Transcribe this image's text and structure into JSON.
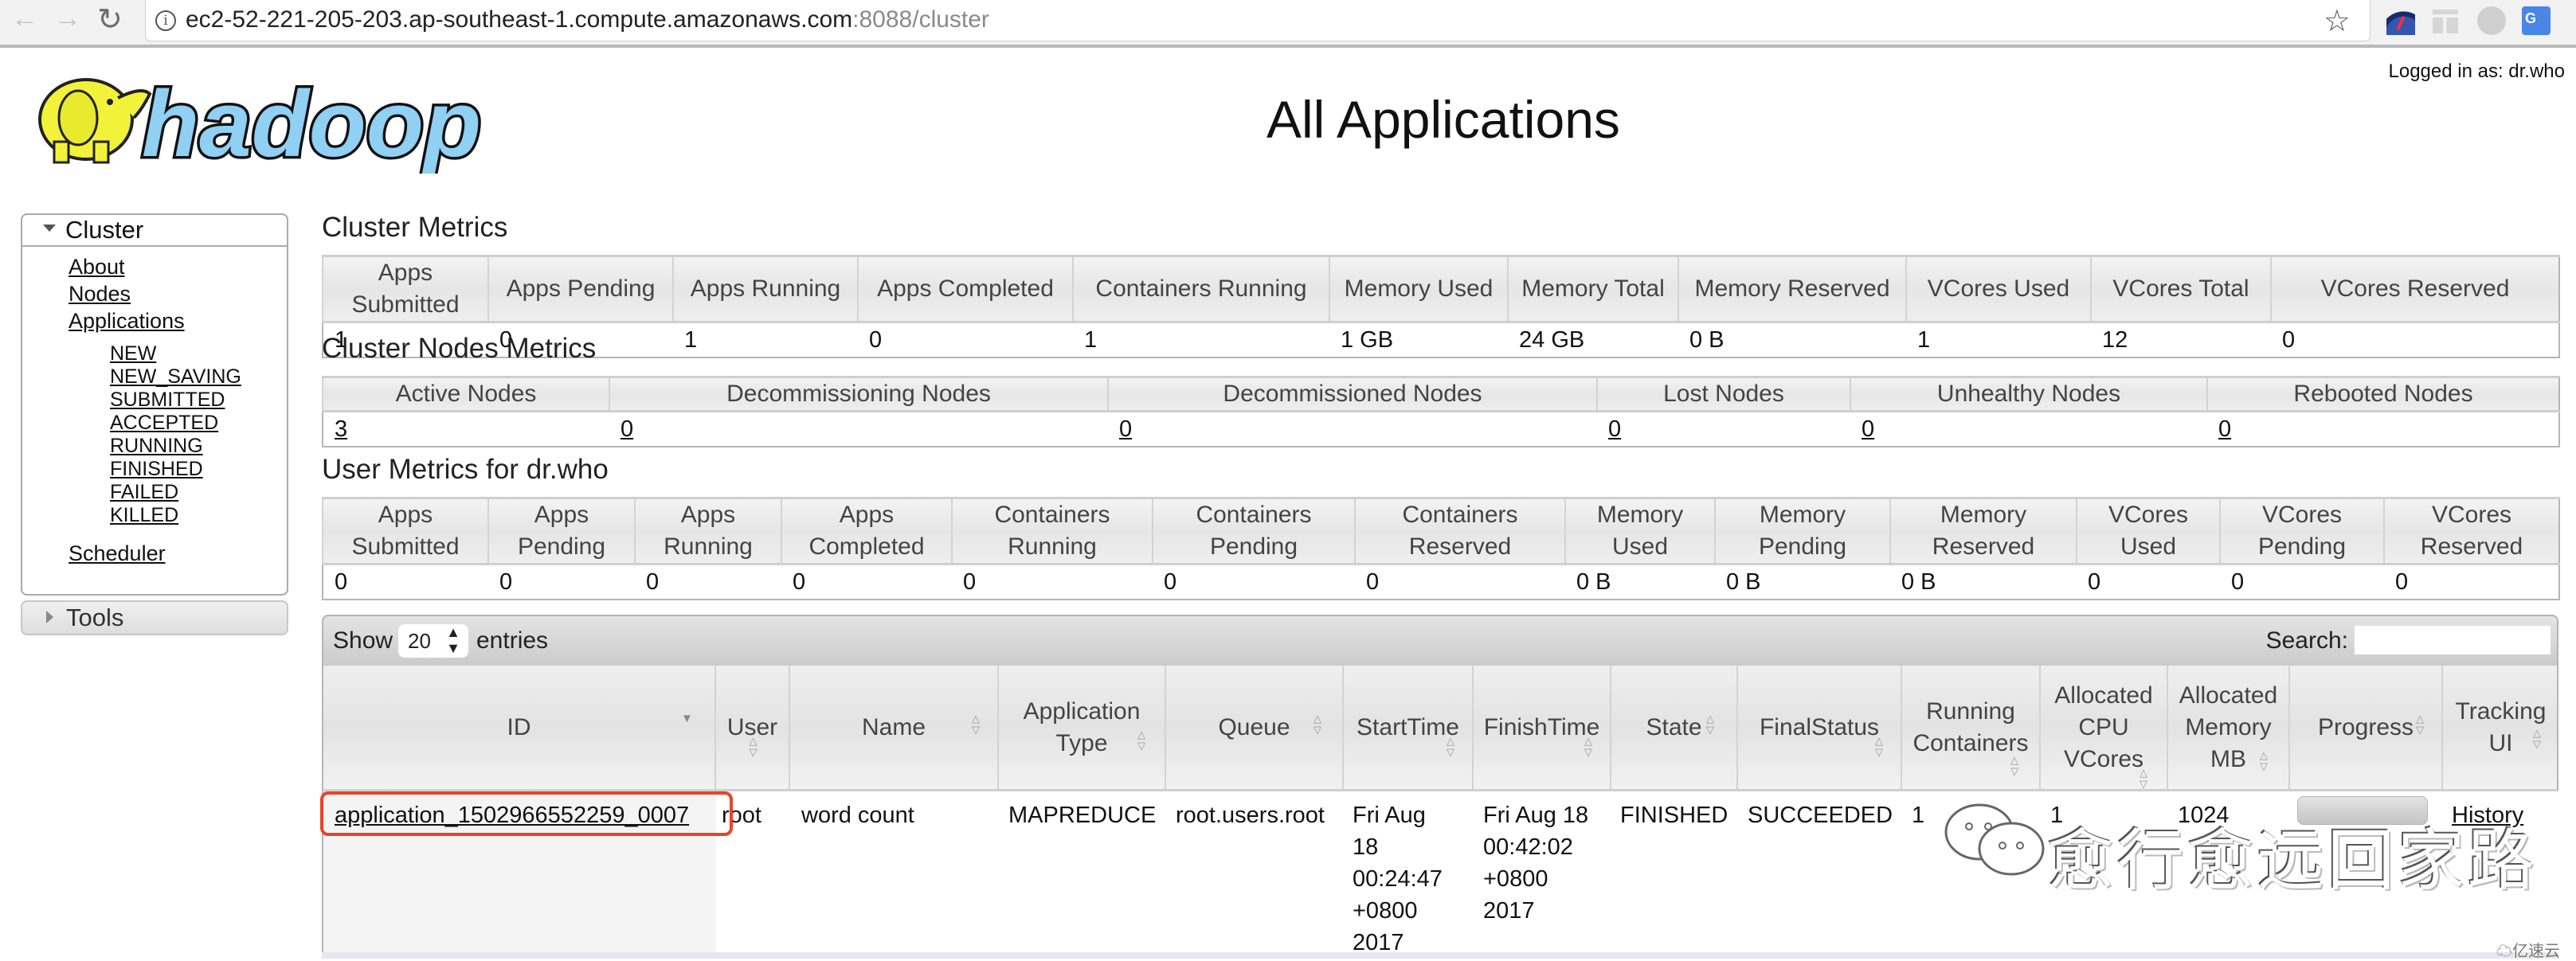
{
  "browser": {
    "url_main": "ec2-52-221-205-203.ap-southeast-1.compute.amazonaws.com",
    "url_tail": ":8088/cluster",
    "icons": {
      "back": "←",
      "forward": "→",
      "reload": "↻",
      "info": "i",
      "star": "☆",
      "translate": "G"
    }
  },
  "header": {
    "logged_in": "Logged in as: dr.who",
    "title": "All Applications",
    "logo_text": "hadoop"
  },
  "sidebar": {
    "cluster_label": "Cluster",
    "links": [
      "About",
      "Nodes",
      "Applications"
    ],
    "app_states": [
      "NEW",
      "NEW_SAVING",
      "SUBMITTED",
      "ACCEPTED",
      "RUNNING",
      "FINISHED",
      "FAILED",
      "KILLED"
    ],
    "scheduler": "Scheduler",
    "tools_label": "Tools"
  },
  "cluster_metrics": {
    "title": "Cluster Metrics",
    "headers": [
      "Apps Submitted",
      "Apps Pending",
      "Apps Running",
      "Apps Completed",
      "Containers Running",
      "Memory Used",
      "Memory Total",
      "Memory Reserved",
      "VCores Used",
      "VCores Total",
      "VCores Reserved"
    ],
    "values": [
      "1",
      "0",
      "1",
      "0",
      "1",
      "1 GB",
      "24 GB",
      "0 B",
      "1",
      "12",
      "0"
    ]
  },
  "cluster_nodes_metrics": {
    "title": "Cluster Nodes Metrics",
    "headers": [
      "Active Nodes",
      "Decommissioning Nodes",
      "Decommissioned Nodes",
      "Lost Nodes",
      "Unhealthy Nodes",
      "Rebooted Nodes"
    ],
    "values": [
      "3",
      "0",
      "0",
      "0",
      "0",
      "0"
    ]
  },
  "user_metrics": {
    "title": "User Metrics for dr.who",
    "headers": [
      [
        "Apps",
        "Submitted"
      ],
      [
        "Apps",
        "Pending"
      ],
      [
        "Apps",
        "Running"
      ],
      [
        "Apps",
        "Completed"
      ],
      [
        "Containers",
        "Running"
      ],
      [
        "Containers",
        "Pending"
      ],
      [
        "Containers",
        "Reserved"
      ],
      [
        "Memory",
        "Used"
      ],
      [
        "Memory",
        "Pending"
      ],
      [
        "Memory",
        "Reserved"
      ],
      [
        "VCores",
        "Used"
      ],
      [
        "VCores",
        "Pending"
      ],
      [
        "VCores",
        "Reserved"
      ]
    ],
    "values": [
      "0",
      "0",
      "0",
      "0",
      "0",
      "0",
      "0",
      "0 B",
      "0 B",
      "0 B",
      "0",
      "0",
      "0"
    ]
  },
  "apps_table": {
    "show_label": "Show",
    "page_size": "20",
    "entries_label": "entries",
    "search_label": "Search:",
    "search_value": "",
    "columns": [
      {
        "label": [
          "ID"
        ],
        "sort": "desc"
      },
      {
        "label": [
          "User"
        ],
        "sort": "both"
      },
      {
        "label": [
          "Name"
        ],
        "sort": "both"
      },
      {
        "label": [
          "Application",
          "Type"
        ],
        "sort": "both"
      },
      {
        "label": [
          "Queue"
        ],
        "sort": "both"
      },
      {
        "label": [
          "StartTime"
        ],
        "sort": "both"
      },
      {
        "label": [
          "FinishTime"
        ],
        "sort": "both"
      },
      {
        "label": [
          "State"
        ],
        "sort": "both"
      },
      {
        "label": [
          "FinalStatus"
        ],
        "sort": "both"
      },
      {
        "label": [
          "Running",
          "Containers"
        ],
        "sort": "both"
      },
      {
        "label": [
          "Allocated",
          "CPU",
          "VCores"
        ],
        "sort": "both"
      },
      {
        "label": [
          "Allocated",
          "Memory",
          "MB"
        ],
        "sort": "both"
      },
      {
        "label": [
          "Progress"
        ],
        "sort": "both"
      },
      {
        "label": [
          "Tracking",
          "UI"
        ],
        "sort": "both"
      }
    ],
    "rows": [
      {
        "id": "application_1502966552259_0007",
        "user": "root",
        "name": "word count",
        "type": "MAPREDUCE",
        "queue": "root.users.root",
        "start_time": [
          "Fri Aug",
          "18",
          "00:24:47",
          "+0800",
          "2017"
        ],
        "finish_time": [
          "Fri Aug 18",
          "00:42:02",
          "+0800",
          "2017"
        ],
        "state": "FINISHED",
        "final_status": "SUCCEEDED",
        "running_containers": "1",
        "allocated_vcores": "1",
        "allocated_memory_mb": "1024",
        "progress_percent": 100,
        "tracking_ui": "History"
      }
    ]
  },
  "watermark": {
    "text": "愈行愈远回家路",
    "brand": "亿速云"
  },
  "colors": {
    "highlight": "#e8442a",
    "logo_blue": "#8fd0f3",
    "logo_yellow": "#f2f23a"
  }
}
